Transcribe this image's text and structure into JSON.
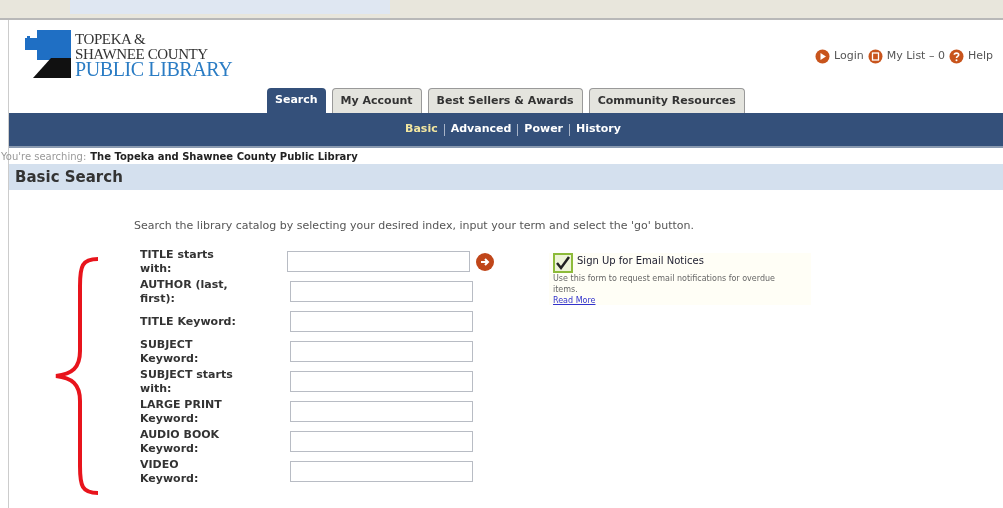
{
  "logo": {
    "line_1": "TOPEKA &",
    "line_2": "SHAWNEE COUNTY",
    "line_3": "PUBLIC LIBRARY"
  },
  "top_links": [
    {
      "kind": "login",
      "label": "Login"
    },
    {
      "kind": "list",
      "label": "My List – 0"
    },
    {
      "kind": "help",
      "label": "Help"
    }
  ],
  "tabs": [
    {
      "label": "Search",
      "selected": true
    },
    {
      "label": "My Account",
      "selected": false
    },
    {
      "label": "Best Sellers & Awards",
      "selected": false
    },
    {
      "label": "Community Resources",
      "selected": false
    }
  ],
  "subnav": [
    {
      "label": "Basic",
      "selected": true
    },
    {
      "label": "Advanced",
      "selected": false
    },
    {
      "label": "Power",
      "selected": false
    },
    {
      "label": "History",
      "selected": false
    }
  ],
  "searching": {
    "prefix": "You're searching:",
    "library": "The Topeka and Shawnee County Public Library"
  },
  "section_title": "Basic Search",
  "instructions": "Search the library catalog by selecting your desired index, input your term and select the 'go' button.",
  "fields": [
    {
      "label": "TITLE starts with:"
    },
    {
      "label": "AUTHOR (last, first):"
    },
    {
      "label": "TITLE Keyword:"
    },
    {
      "label": "SUBJECT Keyword:"
    },
    {
      "label": "SUBJECT starts with:"
    },
    {
      "label": "LARGE PRINT Keyword:"
    },
    {
      "label": "AUDIO BOOK Keyword:"
    },
    {
      "label": "VIDEO Keyword:"
    }
  ],
  "email_notice": {
    "title": "Sign Up for Email Notices",
    "text": "Use this form to request email notifications for overdue items.",
    "link": "Read More"
  }
}
